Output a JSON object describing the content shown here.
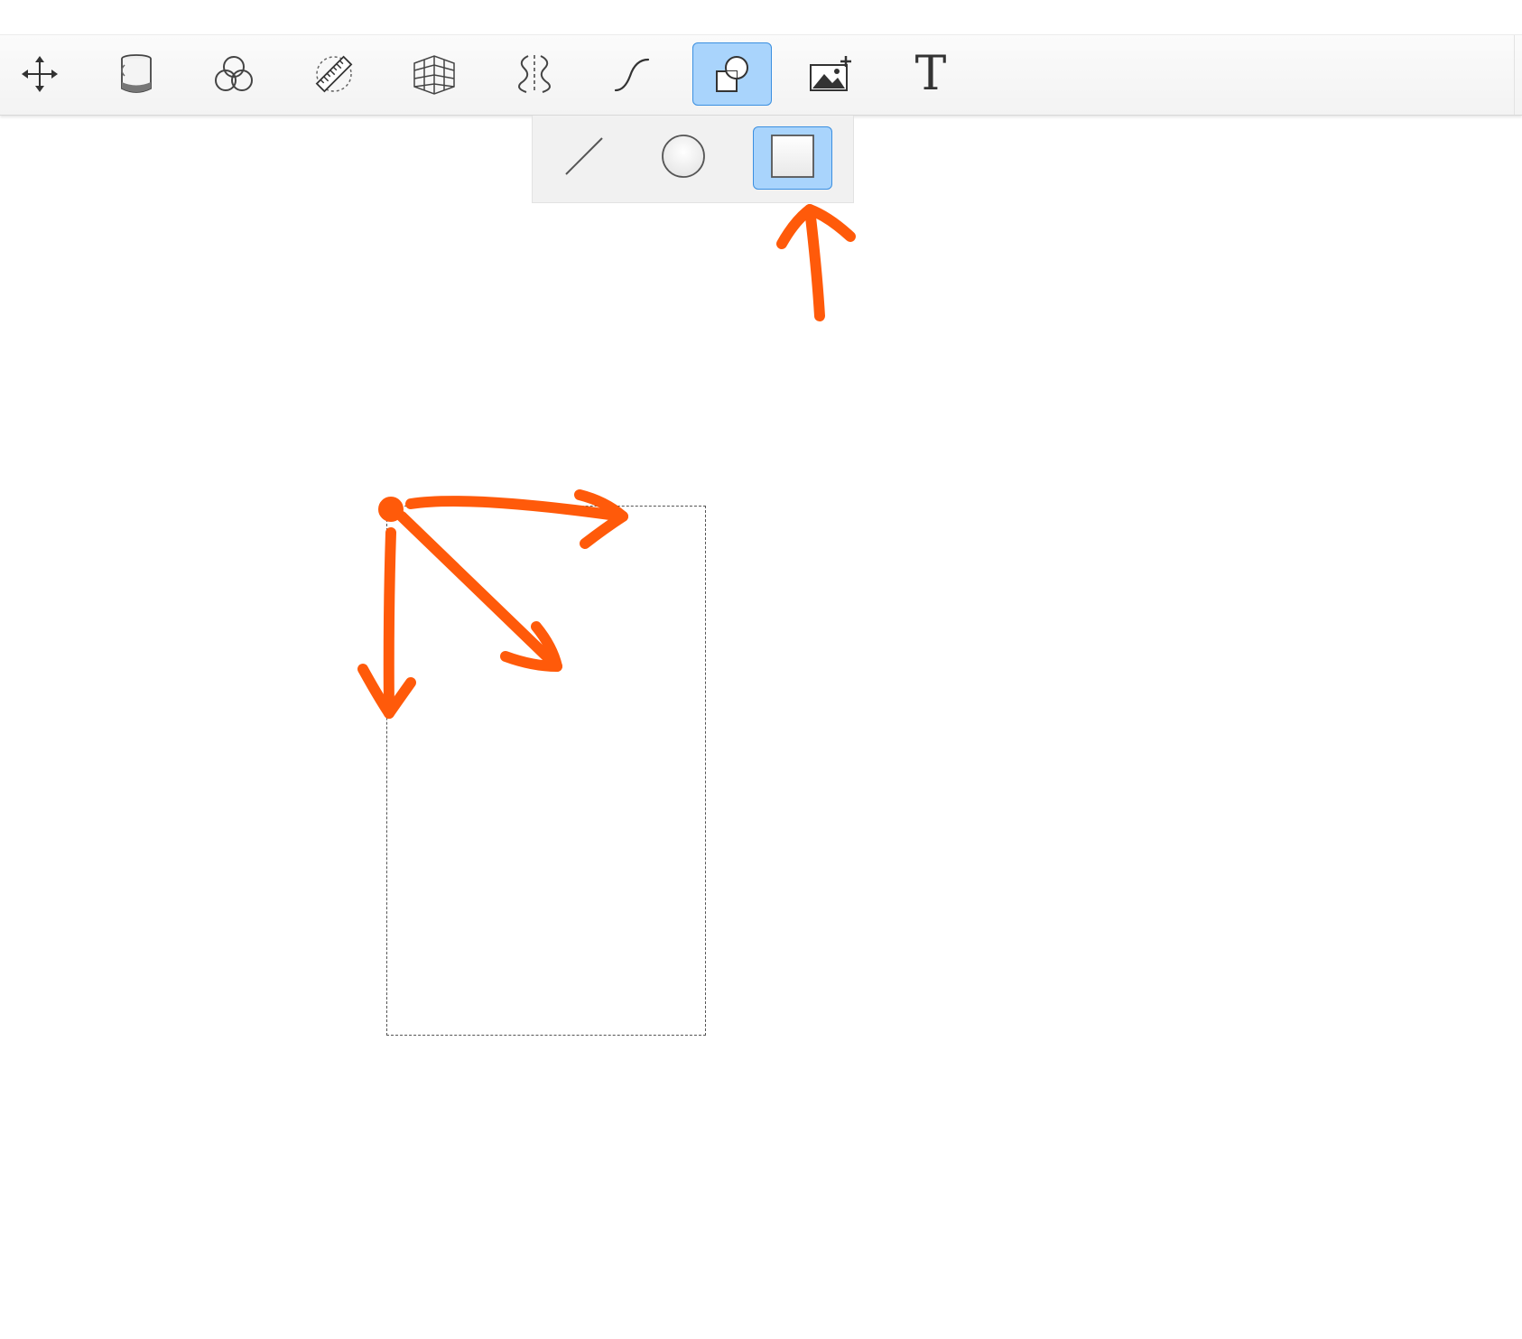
{
  "toolbar": {
    "tools": [
      {
        "name": "move-tool",
        "icon": "move-arrows-icon"
      },
      {
        "name": "fill-tool",
        "icon": "paint-bucket-icon"
      },
      {
        "name": "color-mix-tool",
        "icon": "overlapping-circles-icon"
      },
      {
        "name": "ruler-tool",
        "icon": "ruler-icon"
      },
      {
        "name": "perspective-grid-tool",
        "icon": "perspective-grid-icon"
      },
      {
        "name": "symmetry-tool",
        "icon": "symmetry-icon"
      },
      {
        "name": "curve-tool",
        "icon": "curve-icon"
      },
      {
        "name": "shape-tool",
        "icon": "shapes-icon",
        "active": true
      },
      {
        "name": "image-import-tool",
        "icon": "add-image-icon"
      },
      {
        "name": "text-tool",
        "icon": "text-icon",
        "label": "T"
      }
    ],
    "text_tool_label": "T"
  },
  "shape_popup": {
    "options": [
      {
        "name": "line-shape",
        "icon": "line-icon"
      },
      {
        "name": "ellipse-shape",
        "icon": "circle-icon"
      },
      {
        "name": "rectangle-shape",
        "icon": "square-icon",
        "active": true
      }
    ]
  },
  "colors": {
    "active_fill": "#a9d4fc",
    "active_border": "#3b8fe0",
    "annotation": "#ff5a0a",
    "toolbar_bg": "#f5f5f5"
  }
}
